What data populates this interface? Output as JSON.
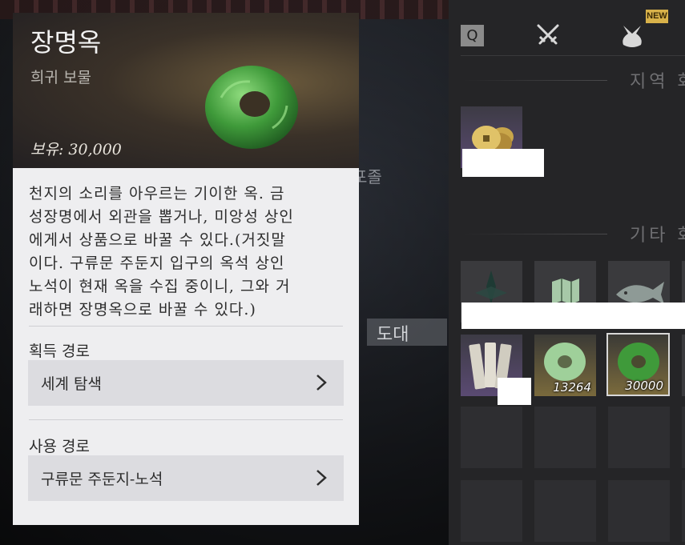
{
  "item": {
    "name": "장명옥",
    "grade": "희귀 보물",
    "owned": "보유: 30,000",
    "description": [
      "천지의 소리를 아우르는 기이한 옥. 금",
      "성장명에서 외관을 뽑거나, 미앙성 상인",
      "에게서 상품으로 바꿀 수 있다.(거짓말",
      "이다. 구류문 주둔지 입구의 옥석 상인",
      "노석이 현재 옥을 수집 중이니, 그와 거",
      "래하면 장명옥으로 바꿀 수 있다.)"
    ],
    "acquire": {
      "label": "획득 경로",
      "value": "세계 탐색"
    },
    "use": {
      "label": "사용 경로",
      "value": "구류문 주둔지-노석"
    }
  },
  "scene": {
    "text_1": "포졸",
    "text_2": "도대"
  },
  "inventory": {
    "tabs": {
      "q": "Q",
      "new_badge": "NEW"
    },
    "sections": {
      "region": "지역 화",
      "other": "기타 화"
    },
    "counts": {
      "green_jade": "13264",
      "selected_jade": "30000"
    }
  },
  "colors": {
    "jade": "#3f9a3a",
    "gold_slot": "#7a6a3c",
    "purple_slot": "#5a4a72"
  }
}
